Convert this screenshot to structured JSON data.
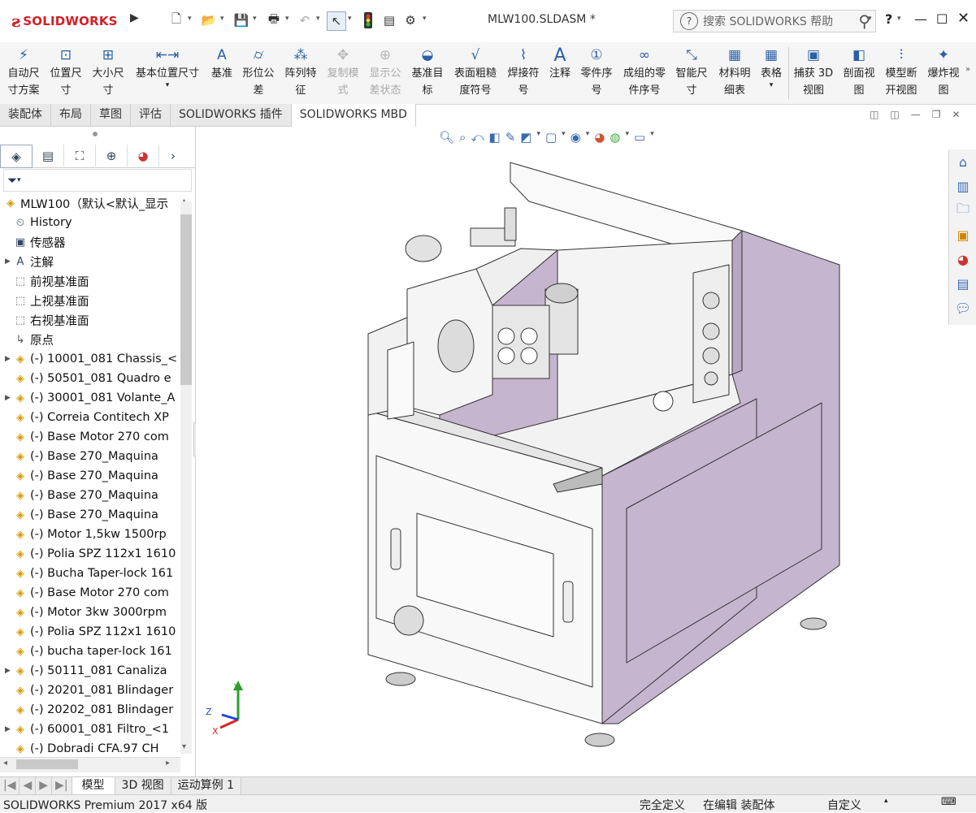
{
  "app": {
    "brand": "SOLIDWORKS",
    "document_title": "MLW100.SLDASM *",
    "search_placeholder": "搜索 SOLIDWORKS 帮助",
    "help_label": "?"
  },
  "commands": [
    {
      "label": "自动尺\n寸方案",
      "icon": "auto-dimension-icon",
      "enabled": true
    },
    {
      "label": "位置尺\n寸",
      "icon": "location-dimension-icon",
      "enabled": true
    },
    {
      "label": "大小尺\n寸",
      "icon": "size-dimension-icon",
      "enabled": true
    },
    {
      "label": "基本位置尺寸",
      "icon": "basic-location-dimension-icon",
      "enabled": true
    },
    {
      "label": "基准",
      "icon": "datum-icon",
      "enabled": true
    },
    {
      "label": "形位公\n差",
      "icon": "geometric-tolerance-icon",
      "enabled": true
    },
    {
      "label": "阵列特\n征",
      "icon": "pattern-feature-icon",
      "enabled": true
    },
    {
      "label": "复制模\n式",
      "icon": "copy-scheme-icon",
      "enabled": false
    },
    {
      "label": "显示公\n差状态",
      "icon": "show-tolerance-status-icon",
      "enabled": false
    },
    {
      "label": "基准目\n标",
      "icon": "datum-target-icon",
      "enabled": true
    },
    {
      "label": "表面粗糙\n度符号",
      "icon": "surface-finish-icon",
      "enabled": true
    },
    {
      "label": "焊接符\n号",
      "icon": "weld-symbol-icon",
      "enabled": true
    },
    {
      "label": "注释",
      "icon": "note-icon",
      "enabled": true
    },
    {
      "label": "零件序\n号",
      "icon": "balloon-icon",
      "enabled": true
    },
    {
      "label": "成组的零\n件序号",
      "icon": "stacked-balloon-icon",
      "enabled": true
    },
    {
      "label": "智能尺\n寸",
      "icon": "smart-dimension-icon",
      "enabled": true
    },
    {
      "label": "材料明\n细表",
      "icon": "bill-of-materials-icon",
      "enabled": true
    },
    {
      "label": "表格",
      "icon": "table-icon",
      "enabled": true
    },
    {
      "label": "捕获 3D\n视图",
      "icon": "capture-3d-view-icon",
      "enabled": true
    },
    {
      "label": "剖面视\n图",
      "icon": "section-view-icon",
      "enabled": true
    },
    {
      "label": "模型断\n开视图",
      "icon": "model-break-view-icon",
      "enabled": true
    },
    {
      "label": "爆炸视\n图",
      "icon": "exploded-view-icon",
      "enabled": true
    }
  ],
  "tabs": [
    {
      "label": "装配体",
      "active": false
    },
    {
      "label": "布局",
      "active": false
    },
    {
      "label": "草图",
      "active": false
    },
    {
      "label": "评估",
      "active": false
    },
    {
      "label": "SOLIDWORKS 插件",
      "active": false
    },
    {
      "label": "SOLIDWORKS MBD",
      "active": true
    }
  ],
  "tree": {
    "root": "MLW100（默认<默认_显示",
    "items": [
      {
        "label": "History",
        "icon": "history-icon",
        "expandable": false
      },
      {
        "label": "传感器",
        "icon": "sensor-icon",
        "expandable": false
      },
      {
        "label": "注解",
        "icon": "annotations-icon",
        "expandable": true
      },
      {
        "label": "前视基准面",
        "icon": "plane-icon",
        "expandable": false
      },
      {
        "label": "上视基准面",
        "icon": "plane-icon",
        "expandable": false
      },
      {
        "label": "右视基准面",
        "icon": "plane-icon",
        "expandable": false
      },
      {
        "label": "原点",
        "icon": "origin-icon",
        "expandable": false
      },
      {
        "label": "(-) 10001_081 Chassis_<",
        "icon": "assembly-icon",
        "expandable": true
      },
      {
        "label": "(-) 50501_081 Quadro e",
        "icon": "part-icon",
        "expandable": false
      },
      {
        "label": "(-) 30001_081 Volante_A",
        "icon": "assembly-icon",
        "expandable": true
      },
      {
        "label": "(-) Correia Contitech XP",
        "icon": "part-icon",
        "expandable": false
      },
      {
        "label": "(-) Base Motor 270 com",
        "icon": "part-icon",
        "expandable": false
      },
      {
        "label": "(-) Base  270_Maquina",
        "icon": "part-icon",
        "expandable": false
      },
      {
        "label": "(-) Base  270_Maquina",
        "icon": "part-icon",
        "expandable": false
      },
      {
        "label": "(-) Base  270_Maquina",
        "icon": "part-icon",
        "expandable": false
      },
      {
        "label": "(-) Base  270_Maquina",
        "icon": "part-icon",
        "expandable": false
      },
      {
        "label": "(-) Motor 1,5kw 1500rp",
        "icon": "part-icon",
        "expandable": false
      },
      {
        "label": "(-) Polia SPZ 112x1 1610",
        "icon": "part-icon",
        "expandable": false
      },
      {
        "label": "(-) Bucha Taper-lock 161",
        "icon": "part-icon",
        "expandable": false
      },
      {
        "label": "(-) Base Motor 270 com",
        "icon": "part-icon",
        "expandable": false
      },
      {
        "label": "(-) Motor 3kw 3000rpm",
        "icon": "part-icon",
        "expandable": false
      },
      {
        "label": "(-) Polia SPZ 112x1 1610",
        "icon": "part-icon",
        "expandable": false
      },
      {
        "label": "(-) bucha taper-lock 161",
        "icon": "part-icon",
        "expandable": false
      },
      {
        "label": "(-) 50111_081 Canaliza",
        "icon": "assembly-icon",
        "expandable": true
      },
      {
        "label": "(-) 20201_081 Blindager",
        "icon": "part-icon",
        "expandable": false
      },
      {
        "label": "(-) 20202_081 Blindager",
        "icon": "part-icon",
        "expandable": false
      },
      {
        "label": "(-) 60001_081 Filtro_<1",
        "icon": "assembly-icon",
        "expandable": true
      },
      {
        "label": "(-) Dobradi CFA.97 CH",
        "icon": "part-icon",
        "expandable": false
      }
    ]
  },
  "bottom_tabs": [
    {
      "label": "模型",
      "active": true
    },
    {
      "label": "3D 视图",
      "active": false
    },
    {
      "label": "运动算例 1",
      "active": false
    }
  ],
  "status": {
    "product": "SOLIDWORKS Premium 2017 x64 版",
    "definition": "完全定义",
    "mode": "在编辑 装配体",
    "units": "自定义"
  },
  "triad": {
    "x": "X",
    "y": "Y",
    "z": "Z"
  },
  "colors": {
    "brand_red": "#d21f26",
    "model_purple": "#c3b2cc",
    "model_white": "#f8f8f8",
    "accent_blue": "#2b5fa8"
  }
}
